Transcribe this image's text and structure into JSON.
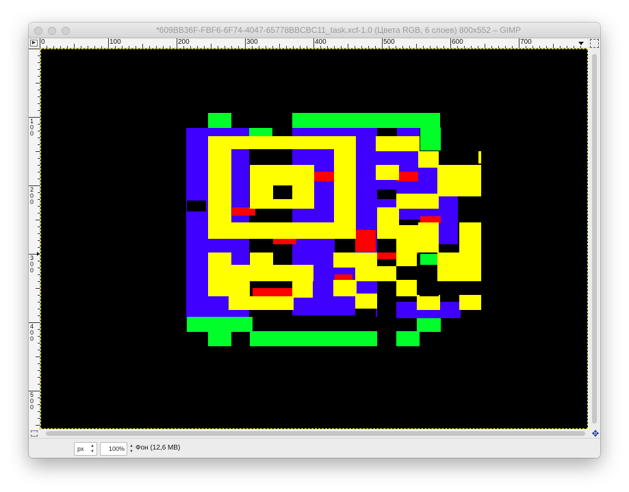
{
  "window": {
    "title": "*609BB36F-FBF6-6F74-4047-65778BBCBC11_task.xcf-1.0 (Цвета RGB, 6 слоев) 800x552 – GIMP"
  },
  "ruler": {
    "horizontal_labels": [
      "0",
      "100",
      "200",
      "300",
      "400",
      "500",
      "600",
      "700"
    ],
    "vertical_labels": [
      "1\n0\n0",
      "2\n0\n0",
      "3\n0\n0",
      "4\n0\n0",
      "5\n0\n0"
    ]
  },
  "icons": {
    "ruler_menu": "play-triangle-icon",
    "navigate": "navigate-icon",
    "quick_mask": "quick-mask-icon",
    "move": "move-arrows-icon"
  },
  "statusbar": {
    "unit": "px",
    "zoom": "100%",
    "layer_info": "Фон (12,6 MB)"
  },
  "canvas": {
    "background": "#000000",
    "colors": {
      "green": "#00ff2a",
      "blue": "#4000ff",
      "yellow": "#ffff00",
      "red": "#ff0000"
    }
  }
}
